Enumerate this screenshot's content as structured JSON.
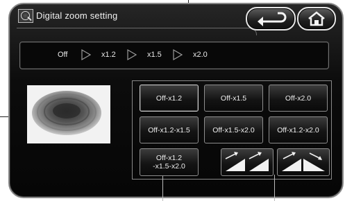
{
  "header": {
    "title": "Digital zoom setting",
    "title_icon": "zoom-picture-icon",
    "back_icon": "return-arrow-icon",
    "home_icon": "home-icon"
  },
  "sequence": {
    "steps": [
      "Off",
      "x1.2",
      "x1.5",
      "x2.0"
    ],
    "arrow_icon": "triangle-right-outline-icon"
  },
  "presets": {
    "buttons": [
      "Off-x1.2",
      "Off-x1.5",
      "Off-x2.0",
      "Off-x1.2-x1.5",
      "Off-x1.5-x2.0",
      "Off-x1.2-x2.0",
      "Off-x1.2\n-x1.5-x2.0"
    ],
    "animation_buttons": [
      {
        "icon": "zoom-in-ramp-icon"
      },
      {
        "icon": "zoom-in-out-ramp-icon"
      }
    ]
  },
  "colors": {
    "panel_background": "#0c0c0c",
    "button_border": "#8e8e8e",
    "text": "#f0f0f0"
  }
}
